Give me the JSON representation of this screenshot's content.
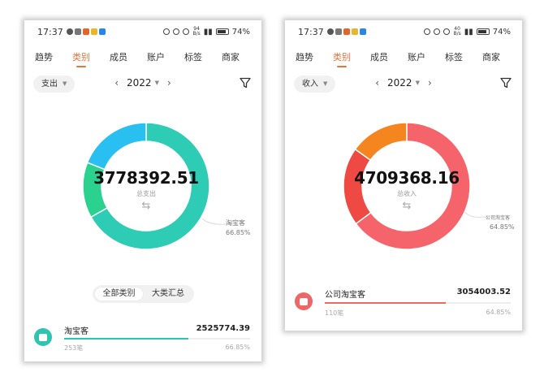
{
  "screens": [
    {
      "status": {
        "time": "17:37",
        "battery": "74%",
        "net_top": "94",
        "net_bottom": "B/s"
      },
      "tabs": [
        "趋势",
        "类别",
        "成员",
        "账户",
        "标签",
        "商家"
      ],
      "active_tab": 1,
      "type_selector": "支出",
      "year": "2022",
      "center": {
        "amount": "3778392.51",
        "label": "总支出",
        "swap": "⇆"
      },
      "segments": [
        {
          "value": 66.85,
          "color": "#2ecbb5"
        },
        {
          "value": 14.2,
          "color": "#2ad18f"
        },
        {
          "value": 18.95,
          "color": "#29bff0"
        }
      ],
      "callout": {
        "name": "淘宝客",
        "pct": "66.85%"
      },
      "view_toggle": {
        "options": [
          "全部类别",
          "大类汇总"
        ],
        "selected": 0
      },
      "rows": [
        {
          "name": "淘宝客",
          "amount": "2525774.39",
          "count": "253笔",
          "percent": "66.85%",
          "share": 0.6685,
          "color": "#2ec4b2"
        }
      ]
    },
    {
      "status": {
        "time": "17:37",
        "battery": "74%",
        "net_top": "40",
        "net_bottom": "B/s"
      },
      "tabs": [
        "趋势",
        "类别",
        "成员",
        "账户",
        "标签",
        "商家"
      ],
      "active_tab": 1,
      "type_selector": "收入",
      "year": "2022",
      "center": {
        "amount": "4709368.16",
        "label": "总收入",
        "swap": "⇆"
      },
      "segments": [
        {
          "value": 64.85,
          "color": "#f6646b"
        },
        {
          "value": 20.0,
          "color": "#ee4a43"
        },
        {
          "value": 15.15,
          "color": "#f4851f"
        }
      ],
      "callout": {
        "name": "公司淘宝客",
        "pct": "64.85%"
      },
      "rows": [
        {
          "name": "公司淘宝客",
          "amount": "3054003.52",
          "count": "110笔",
          "percent": "64.85%",
          "share": 0.6485,
          "color": "#ee6666"
        }
      ]
    }
  ]
}
